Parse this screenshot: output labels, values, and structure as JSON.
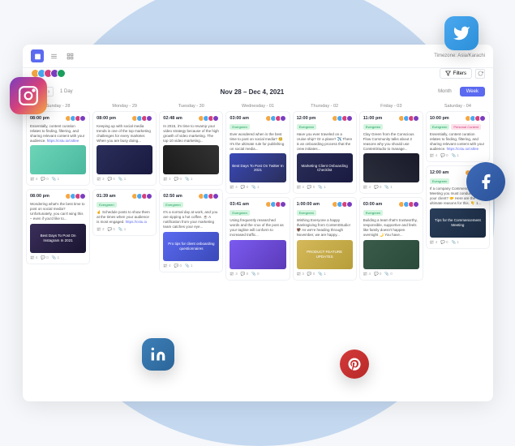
{
  "toolbar": {
    "timezone_label": "Timezone: Asia/Karachi",
    "filters_label": "Filters"
  },
  "header": {
    "date_range": "Nov 28 – Dec 4, 2021",
    "month_label": "Month",
    "week_label": "Week",
    "filter_label": "1 Day"
  },
  "avatars": {
    "colors": [
      "#f5a742",
      "#4aa8f0",
      "#d4417c",
      "#7b3dbf",
      "#1a9e5c"
    ]
  },
  "days": [
    {
      "label": "Sunday - 28",
      "cards": [
        {
          "time": "08:00 pm",
          "tags": [],
          "text": "Essentially, content curation relates to finding, filtering, and sharing relevant content with your audience.",
          "link": "https://cstu.io/cstlee",
          "img": {
            "bg": "linear-gradient(135deg,#6dd5b8,#4ab89e)",
            "text": ""
          },
          "footer": [
            "4",
            "0",
            "1"
          ]
        },
        {
          "time": "08:00 pm",
          "tags": [],
          "text": "Wondering what's the best time to post on social media? Unfortunately, you can't wing this – even if you'd like to...",
          "img": {
            "bg": "linear-gradient(135deg,#3a2e5a,#1a1530)",
            "text": "Best Days To Post On Instagram In 2021"
          },
          "footer": [
            "4",
            "0",
            "1"
          ]
        }
      ]
    },
    {
      "label": "Monday - 29",
      "cards": [
        {
          "time": "08:00 pm",
          "tags": [],
          "text": "Keeping up with social media trends is one of the top marketing challenges for every marketer. When you are busy doing...",
          "img": {
            "bg": "linear-gradient(135deg,#2a2e5a,#1a1a40)",
            "text": ""
          },
          "footer": [
            "3",
            "0",
            "1"
          ]
        },
        {
          "time": "01:39 am",
          "tags": [
            {
              "cls": "green",
              "t": "Evergreen"
            }
          ],
          "text": "☝️ Schedule posts to show them at the times when your audience is most engaged.",
          "link": "https://cstu.io",
          "footer": [
            "3",
            "0",
            "1"
          ]
        }
      ]
    },
    {
      "label": "Tuesday - 30",
      "cards": [
        {
          "time": "02:48 am",
          "tags": [],
          "text": "In 2015, it's time to revamp your video strategy because of the high growth of video marketing. The top 10 video marketing...",
          "img": {
            "bg": "linear-gradient(45deg,#1a1a1a,#333)",
            "text": ""
          },
          "footer": [
            "4",
            "0",
            "1"
          ]
        },
        {
          "time": "02:50 am",
          "tags": [
            {
              "cls": "green",
              "t": "Evergreen"
            }
          ],
          "text": "It's a normal day at work, and you are sipping a hot coffee. ☕ A notification from your marketing team catches your eye...",
          "img": {
            "bg": "linear-gradient(135deg,#5b6af0,#3a4ab8)",
            "text": "Pro tips for client onboarding questionnaires"
          },
          "footer": [
            "4",
            "0",
            "1"
          ]
        }
      ]
    },
    {
      "label": "Wednesday - 01",
      "cards": [
        {
          "time": "03:00 am",
          "tags": [
            {
              "cls": "green",
              "t": "Evergreen"
            }
          ],
          "text": "Ever wondered when is the best time to post on social media? 🧐 It's the ultimate rule for publishing on social media...",
          "img": {
            "bg": "linear-gradient(135deg,#3a4ab8,#2a2e5a)",
            "text": "Best Days To Post On Twitter In 2021"
          },
          "footer": [
            "4",
            "0",
            "1"
          ]
        },
        {
          "time": "03:41 am",
          "tags": [
            {
              "cls": "green",
              "t": "Evergreen"
            }
          ],
          "text": "Using frequently researched words and the crux of the post as your tagline will conform to increased traffic...",
          "img": {
            "bg": "linear-gradient(135deg,#7b5bf0,#5b3ab8)",
            "text": ""
          },
          "footer": [
            "3",
            "0",
            "0"
          ]
        }
      ]
    },
    {
      "label": "Thursday - 02",
      "cards": [
        {
          "time": "12:00 pm",
          "tags": [
            {
              "cls": "green",
              "t": "Evergreen"
            }
          ],
          "text": "Have you ever traveled on a cruise ship? Or a plane? ✈️ There is an onboarding process that the crew initiates...",
          "img": {
            "bg": "linear-gradient(135deg,#2a2e5a,#1a1a40)",
            "text": "Marketing Client Onboarding Checklist"
          },
          "footer": [
            "4",
            "0",
            "1"
          ]
        },
        {
          "time": "1:00:00 am",
          "tags": [
            {
              "cls": "green",
              "t": "Evergreen"
            }
          ],
          "text": "Wishing Everyone a happy thanksgiving from ContentStudio! 🦃 As we're heading through November, we are happy...",
          "img": {
            "bg": "linear-gradient(135deg,#d4b85a,#b89e3a)",
            "text": "PRODUCT FEATURE UPDATES"
          },
          "footer": [
            "3",
            "0",
            "1"
          ]
        }
      ]
    },
    {
      "label": "Friday - 03",
      "cards": [
        {
          "time": "11:00 pm",
          "tags": [
            {
              "cls": "green",
              "t": "Evergreen"
            }
          ],
          "text": "Clay Green from the Conscious Flow Community talks about 2 reasons why you should use ContentStudio to manage...",
          "img": {
            "bg": "linear-gradient(45deg,#2a2e3b,#1a1a2a)",
            "text": ""
          },
          "footer": [
            "4",
            "0",
            "1"
          ]
        },
        {
          "time": "03:00 am",
          "tags": [
            {
              "cls": "green",
              "t": "Evergreen"
            }
          ],
          "text": "Building a team that's trustworthy, responsible, supportive and feels like family doesn't happen overnight 🌙 You have...",
          "img": {
            "bg": "linear-gradient(135deg,#3a5a4a,#2a4a3a)",
            "text": ""
          },
          "footer": [
            "4",
            "0",
            "0"
          ]
        }
      ]
    },
    {
      "label": "Saturday - 04",
      "cards": [
        {
          "time": "10:00 pm",
          "tags": [
            {
              "cls": "green",
              "t": "Evergreen"
            },
            {
              "cls": "pink",
              "t": "Personal Content"
            }
          ],
          "text": "Essentially, content curation relates to finding, filtering, and sharing relevant content with your audience.",
          "link": "https://cstu.io/cstlee",
          "footer": [
            "4",
            "0",
            "1"
          ]
        },
        {
          "time": "12:00 am",
          "tags": [
            {
              "cls": "green",
              "t": "Evergreen"
            }
          ],
          "text": "If a company Commencement Meeting you must conduct with your client? 🤝 Here are the ultimate reasons for this. 👇 1...",
          "img": {
            "bg": "linear-gradient(135deg,#2a3e5a,#1a2a40)",
            "text": "Tips for the Commencement Meeting"
          },
          "footer": [
            "4",
            "0",
            "1"
          ]
        }
      ]
    }
  ],
  "icons": {
    "twitter": "twitter",
    "instagram": "instagram",
    "facebook": "facebook",
    "linkedin": "linkedin",
    "pinterest": "pinterest"
  }
}
